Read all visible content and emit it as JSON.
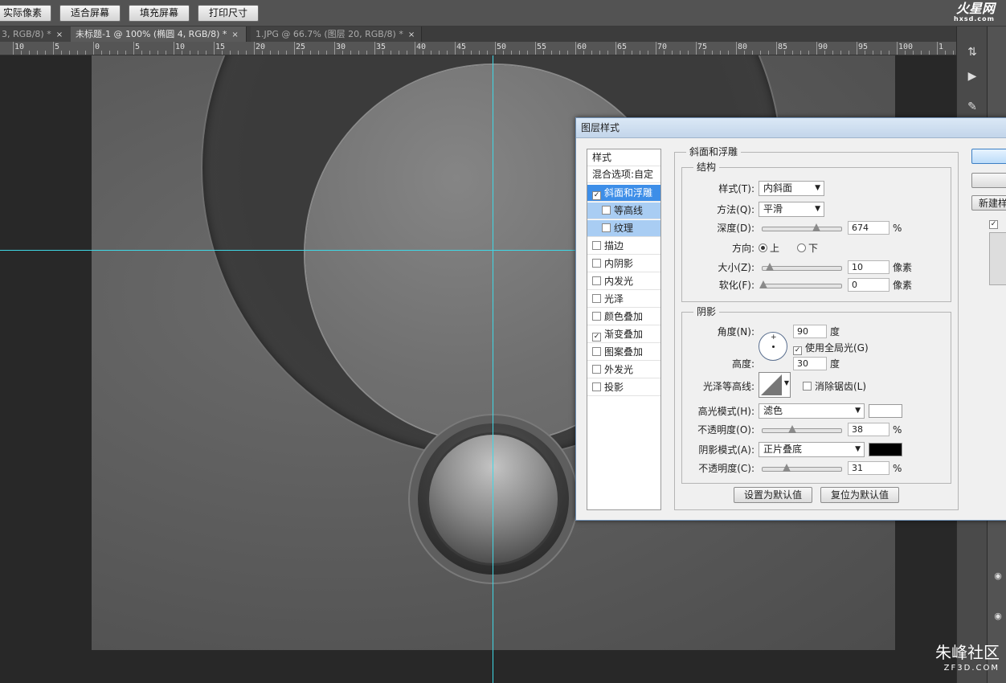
{
  "options_bar": {
    "buttons": [
      "实际像素",
      "适合屏幕",
      "填充屏幕",
      "打印尺寸"
    ],
    "logo_text": "火星网",
    "logo_sub": "hxsd.com"
  },
  "tabs": [
    {
      "label": "3, RGB/8) *",
      "close": "×"
    },
    {
      "label": "未标题-1 @ 100% (椭圆 4, RGB/8) *",
      "close": "×"
    },
    {
      "label": "1.JPG @ 66.7% (图层 20, RGB/8) *",
      "close": "×"
    }
  ],
  "ruler": {
    "labels": [
      "10",
      "5",
      "0",
      "5",
      "10",
      "15",
      "20",
      "25",
      "30",
      "35",
      "40",
      "45",
      "50",
      "55",
      "60",
      "65",
      "70",
      "75",
      "80",
      "85",
      "90",
      "95",
      "100",
      "1"
    ]
  },
  "dialog": {
    "title": "图层样式",
    "style_list": {
      "header": "样式",
      "blend": "混合选项:自定",
      "items": [
        {
          "label": "斜面和浮雕",
          "checked": true,
          "mark": "✓"
        },
        {
          "label": "等高线",
          "checked": false,
          "mark": ""
        },
        {
          "label": "纹理",
          "checked": false,
          "mark": ""
        },
        {
          "label": "描边",
          "checked": false,
          "mark": ""
        },
        {
          "label": "内阴影",
          "checked": false,
          "mark": ""
        },
        {
          "label": "内发光",
          "checked": false,
          "mark": ""
        },
        {
          "label": "光泽",
          "checked": false,
          "mark": ""
        },
        {
          "label": "颜色叠加",
          "checked": false,
          "mark": ""
        },
        {
          "label": "渐变叠加",
          "checked": true,
          "mark": "✓"
        },
        {
          "label": "图案叠加",
          "checked": false,
          "mark": ""
        },
        {
          "label": "外发光",
          "checked": false,
          "mark": ""
        },
        {
          "label": "投影",
          "checked": false,
          "mark": ""
        }
      ]
    },
    "bevel": {
      "section": "斜面和浮雕",
      "structure": "结构",
      "style_label": "样式(T):",
      "style_value": "内斜面",
      "technique_label": "方法(Q):",
      "technique_value": "平滑",
      "depth_label": "深度(D):",
      "depth_value": "674",
      "depth_unit": "%",
      "direction_label": "方向:",
      "dir_up": "上",
      "dir_down": "下",
      "size_label": "大小(Z):",
      "size_value": "10",
      "size_unit": "像素",
      "soften_label": "软化(F):",
      "soften_value": "0",
      "soften_unit": "像素"
    },
    "shading": {
      "section": "阴影",
      "angle_label": "角度(N):",
      "angle_value": "90",
      "angle_unit": "度",
      "global_light": "使用全局光(G)",
      "global_mark": "✓",
      "altitude_label": "高度:",
      "altitude_value": "30",
      "altitude_unit": "度",
      "gloss_label": "光泽等高线:",
      "antialias": "消除锯齿(L)",
      "highlight_label": "高光模式(H):",
      "highlight_value": "滤色",
      "highlight_color": "#ffffff",
      "hl_opacity_label": "不透明度(O):",
      "hl_opacity_value": "38",
      "hl_opacity_unit": "%",
      "shadow_label": "阴影模式(A):",
      "shadow_value": "正片叠底",
      "shadow_color": "#000000",
      "sh_opacity_label": "不透明度(C):",
      "sh_opacity_value": "31",
      "sh_opacity_unit": "%"
    },
    "buttons": {
      "set_default": "设置为默认值",
      "reset_default": "复位为默认值",
      "new_style": "新建样式"
    }
  },
  "watermark": {
    "main": "朱峰社区",
    "sub": "ZF3D.COM"
  }
}
